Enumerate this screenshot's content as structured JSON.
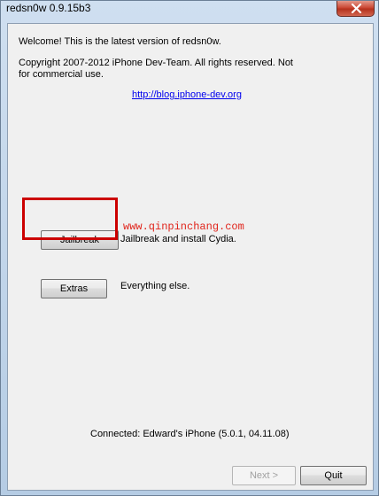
{
  "window": {
    "title": "redsn0w 0.9.15b3"
  },
  "main": {
    "welcome": "Welcome!  This is the latest version of redsn0w.",
    "copyright_line1": "Copyright 2007-2012 iPhone Dev-Team. All rights reserved. Not",
    "copyright_line2": "for commercial use.",
    "link": "http://blog.iphone-dev.org",
    "jailbreak_button": "Jailbreak",
    "jailbreak_desc": "Jailbreak and install Cydia.",
    "watermark": "www.qinpinchang.com",
    "extras_button": "Extras",
    "extras_desc": "Everything else.",
    "connected": "Connected: Edward's iPhone (5.0.1, 04.11.08)"
  },
  "footer": {
    "next_button": "Next >",
    "quit_button": "Quit"
  },
  "colors": {
    "highlight": "#cc0000",
    "watermark": "#e0241b",
    "link": "#0000ee"
  }
}
